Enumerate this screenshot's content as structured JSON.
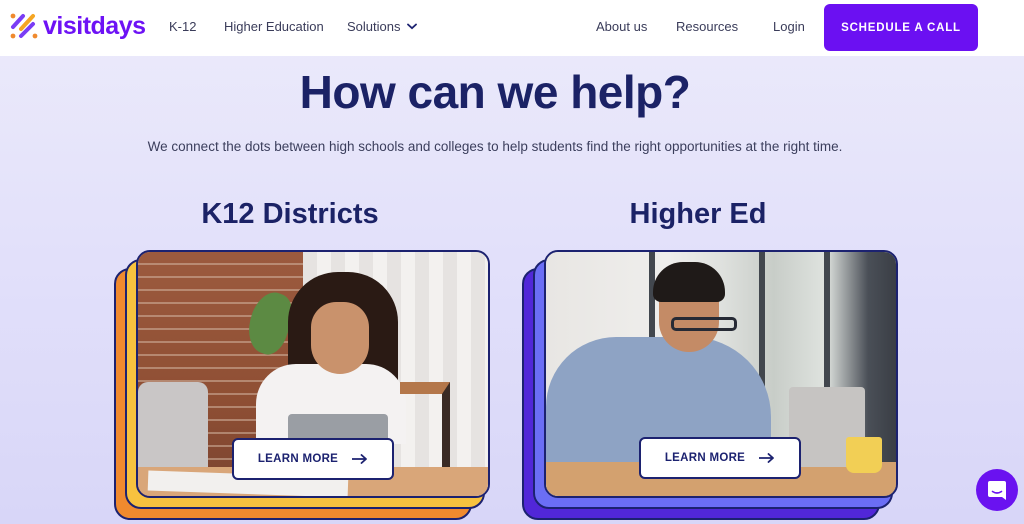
{
  "nav": {
    "brand": "visitdays",
    "links": [
      {
        "label": "K-12"
      },
      {
        "label": "Higher Education"
      },
      {
        "label": "Solutions",
        "has_dropdown": true
      },
      {
        "label": "About us"
      },
      {
        "label": "Resources"
      },
      {
        "label": "Login"
      }
    ],
    "cta_label": "SCHEDULE A CALL"
  },
  "hero": {
    "title": "How can we help?",
    "subtitle": "We connect the dots between high schools and colleges to help students find the right opportunities at the right time."
  },
  "cards": [
    {
      "title": "K12 Districts",
      "button_label": "LEARN MORE",
      "image": "student-girl-writing-with-tablet",
      "accent_colors": [
        "#f7c23f",
        "#f08a2e"
      ]
    },
    {
      "title": "Higher Ed",
      "button_label": "LEARN MORE",
      "image": "student-boy-with-laptop",
      "accent_colors": [
        "#6b6ef5",
        "#5127d8"
      ]
    }
  ],
  "colors": {
    "brand": "#6b10f2",
    "heading": "#1b2266",
    "outline": "#1c2270"
  },
  "chat_widget": {
    "icon": "chat-bubble-icon"
  }
}
